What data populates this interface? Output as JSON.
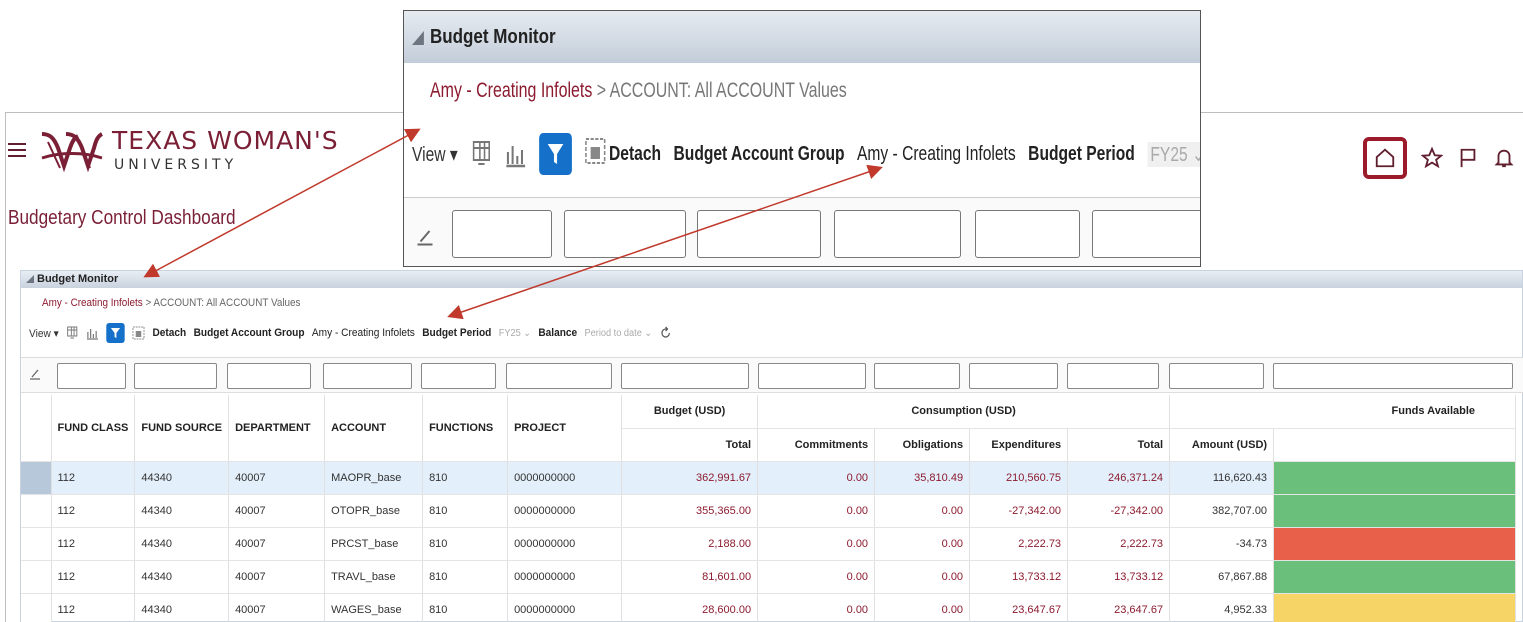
{
  "header": {
    "university_name": "TEXAS WOMAN'S",
    "university_sub": "UNIVERSITY",
    "page_title": "Budgetary Control Dashboard"
  },
  "icons": {
    "menu": "hamburger-menu-icon",
    "home": "home-icon",
    "favorites": "star-icon",
    "flag": "flag-icon",
    "notifications": "bell-icon"
  },
  "colors": {
    "brand": "#7a1f35",
    "home_highlight": "#9b1b2a",
    "arrow": "#c0392b",
    "funds_green": "#6abf7b",
    "funds_red": "#e8604a",
    "funds_yellow": "#f6d466",
    "selected_row": "#e3effa"
  },
  "panel": {
    "title": "Budget Monitor",
    "breadcrumb_link": "Amy - Creating Infolets",
    "breadcrumb_rest": " > ACCOUNT: All ACCOUNT Values",
    "toolbar": {
      "view_label": "View ▾",
      "detach_label": "Detach",
      "budget_account_group_label": "Budget Account Group",
      "budget_account_group_value": "Amy - Creating Infolets",
      "budget_period_label": "Budget Period",
      "budget_period_value": "FY25",
      "balance_label": "Balance",
      "balance_value": "Period to date"
    }
  },
  "zoom": {
    "title": "Budget Monitor",
    "breadcrumb_link": "Amy - Creating Infolets",
    "breadcrumb_rest": " > ACCOUNT: All ACCOUNT Values",
    "view_label": "View ▾",
    "detach_label": "Detach",
    "budget_account_group_label": "Budget Account Group",
    "budget_account_group_value": "Amy - Creating Infolets",
    "budget_period_label": "Budget Period",
    "budget_period_value": "FY25",
    "truncated": "B"
  },
  "table": {
    "headers": {
      "fund_class": "FUND CLASS",
      "fund_source": "FUND SOURCE",
      "department": "DEPARTMENT",
      "account": "ACCOUNT",
      "functions": "FUNCTIONS",
      "project": "PROJECT",
      "budget_group": "Budget (USD)",
      "consumption_group": "Consumption (USD)",
      "funds_group": "Funds Available",
      "budget_total": "Total",
      "commitments": "Commitments",
      "obligations": "Obligations",
      "expenditures": "Expenditures",
      "consumption_total": "Total",
      "amount": "Amount (USD)"
    },
    "rows": [
      {
        "fund_class": "112",
        "fund_source": "44340",
        "department": "40007",
        "account": "MAOPR_base",
        "functions": "810",
        "project": "0000000000",
        "budget": "362,991.67",
        "commitments": "0.00",
        "obligations": "35,810.49",
        "expenditures": "210,560.75",
        "total": "246,371.24",
        "amount": "116,620.43",
        "status": "green"
      },
      {
        "fund_class": "112",
        "fund_source": "44340",
        "department": "40007",
        "account": "OTOPR_base",
        "functions": "810",
        "project": "0000000000",
        "budget": "355,365.00",
        "commitments": "0.00",
        "obligations": "0.00",
        "expenditures": "-27,342.00",
        "total": "-27,342.00",
        "amount": "382,707.00",
        "status": "green"
      },
      {
        "fund_class": "112",
        "fund_source": "44340",
        "department": "40007",
        "account": "PRCST_base",
        "functions": "810",
        "project": "0000000000",
        "budget": "2,188.00",
        "commitments": "0.00",
        "obligations": "0.00",
        "expenditures": "2,222.73",
        "total": "2,222.73",
        "amount": "-34.73",
        "status": "red"
      },
      {
        "fund_class": "112",
        "fund_source": "44340",
        "department": "40007",
        "account": "TRAVL_base",
        "functions": "810",
        "project": "0000000000",
        "budget": "81,601.00",
        "commitments": "0.00",
        "obligations": "0.00",
        "expenditures": "13,733.12",
        "total": "13,733.12",
        "amount": "67,867.88",
        "status": "green"
      },
      {
        "fund_class": "112",
        "fund_source": "44340",
        "department": "40007",
        "account": "WAGES_base",
        "functions": "810",
        "project": "0000000000",
        "budget": "28,600.00",
        "commitments": "0.00",
        "obligations": "0.00",
        "expenditures": "23,647.67",
        "total": "23,647.67",
        "amount": "4,952.33",
        "status": "yellow"
      }
    ]
  }
}
